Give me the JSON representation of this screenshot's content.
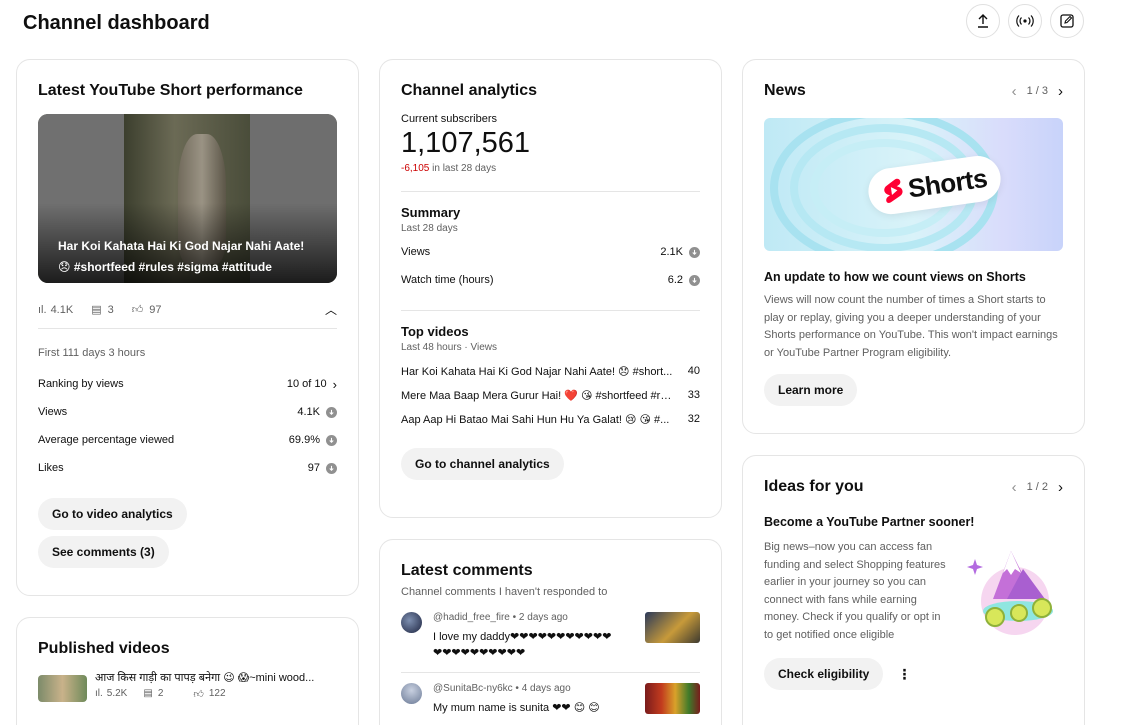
{
  "header": {
    "title": "Channel dashboard"
  },
  "short_card": {
    "title": "Latest YouTube Short performance",
    "thumb_line1": "Har Koi Kahata Hai Ki God Najar Nahi Aate!",
    "thumb_line2": "😞 #shortfeed #rules #sigma #attitude",
    "views": "4.1K",
    "comments": "3",
    "likes": "97",
    "period": "First 111 days 3 hours",
    "stats": [
      {
        "label": "Ranking by views",
        "value": "10 of 10"
      },
      {
        "label": "Views",
        "value": "4.1K"
      },
      {
        "label": "Average percentage viewed",
        "value": "69.9%"
      },
      {
        "label": "Likes",
        "value": "97"
      }
    ],
    "btn_analytics": "Go to video analytics",
    "btn_comments": "See comments (3)"
  },
  "published": {
    "title": "Published videos",
    "items": [
      {
        "title": "आज किस गाड़ी का पापड़ बनेगा 😉 😱~mini wood...",
        "views": "5.2K",
        "comments": "2",
        "likes": "122"
      }
    ]
  },
  "analytics": {
    "title": "Channel analytics",
    "subs_label": "Current subscribers",
    "subs_value": "1,107,561",
    "subs_change": "-6,105",
    "subs_period": " in last 28 days",
    "summary_title": "Summary",
    "summary_period": "Last 28 days",
    "summary": [
      {
        "label": "Views",
        "value": "2.1K"
      },
      {
        "label": "Watch time (hours)",
        "value": "6.2"
      }
    ],
    "top_title": "Top videos",
    "top_period": "Last 48 hours · Views",
    "top": [
      {
        "title": "Har Koi Kahata Hai Ki God Najar Nahi Aate! 😞 #short...",
        "value": "40"
      },
      {
        "title": "Mere Maa Baap Mera Gurur Hai! ❤️ 😘 #shortfeed #rul...",
        "value": "33"
      },
      {
        "title": "Aap Aap Hi Batao Mai Sahi Hun Hu Ya Galat! 😢 😘 #...",
        "value": "32"
      }
    ],
    "btn": "Go to channel analytics"
  },
  "comments": {
    "title": "Latest comments",
    "subtitle": "Channel comments I haven't responded to",
    "items": [
      {
        "author": "@hadid_free_fire",
        "time": " • 2 days ago",
        "text1": "I love my daddy❤❤❤❤❤❤❤❤❤❤❤",
        "text2": "❤❤❤❤❤❤❤❤❤❤"
      },
      {
        "author": "@SunitaBc-ny6kc",
        "time": " • 4 days ago",
        "text1": "My mum name is sunita ❤❤ 😊 😊",
        "text2": ""
      }
    ]
  },
  "news": {
    "title": "News",
    "pager": "1 / 3",
    "image_label": "Shorts",
    "headline": "An update to how we count views on Shorts",
    "body": "Views will now count the number of times a Short starts to play or replay, giving you a deeper understanding of your Shorts performance on YouTube. This won't impact earnings or YouTube Partner Program eligibility.",
    "btn": "Learn more"
  },
  "ideas": {
    "title": "Ideas for you",
    "pager": "1 / 2",
    "headline": "Become a YouTube Partner sooner!",
    "body": "Big news–now you can access fan funding and select Shopping features earlier in your journey so you can connect with fans while earning money. Check if you qualify or opt in to get notified once eligible",
    "btn": "Check eligibility"
  },
  "colors": {
    "negative": "#cc0000",
    "brand_red": "#ff0033"
  }
}
